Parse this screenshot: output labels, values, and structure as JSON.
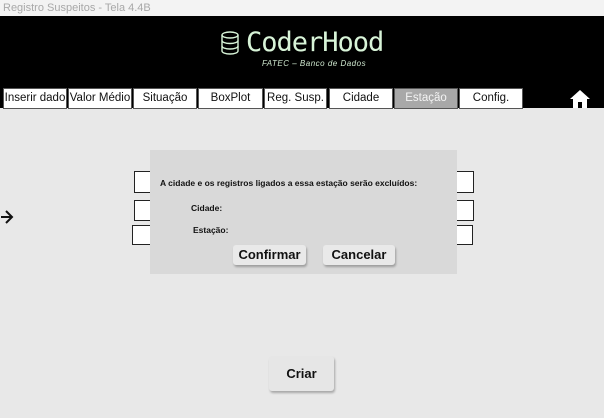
{
  "window": {
    "title": "Registro Suspeitos - Tela 4.4B"
  },
  "header": {
    "logo_icon": "database-icon",
    "logo_text": "CoderHood",
    "subtitle": "FATEC – Banco de Dados",
    "logo_color": "#d8f4d8"
  },
  "tabs": [
    {
      "label": "Inserir dado"
    },
    {
      "label": "Valor Médio"
    },
    {
      "label": "Situação"
    },
    {
      "label": "BoxPlot"
    },
    {
      "label": "Reg. Susp."
    },
    {
      "label": "Cidade"
    },
    {
      "label": "Estação",
      "active": true
    },
    {
      "label": "Config."
    }
  ],
  "home_icon": "home-icon",
  "back_icon": "arrow-right-icon",
  "dialog": {
    "message": "A cidade e os registros ligados a essa estação serão excluídos:",
    "cidade_label": "Cidade:",
    "estacao_label": "Estação:",
    "confirm_label": "Confirmar",
    "cancel_label": "Cancelar"
  },
  "form": {
    "create_label": "Criar"
  },
  "colors": {
    "header_bg": "#000000",
    "active_tab": "#a8a8a8",
    "page_bg": "#e8e8e8",
    "dialog_bg": "#d9d9d9"
  }
}
